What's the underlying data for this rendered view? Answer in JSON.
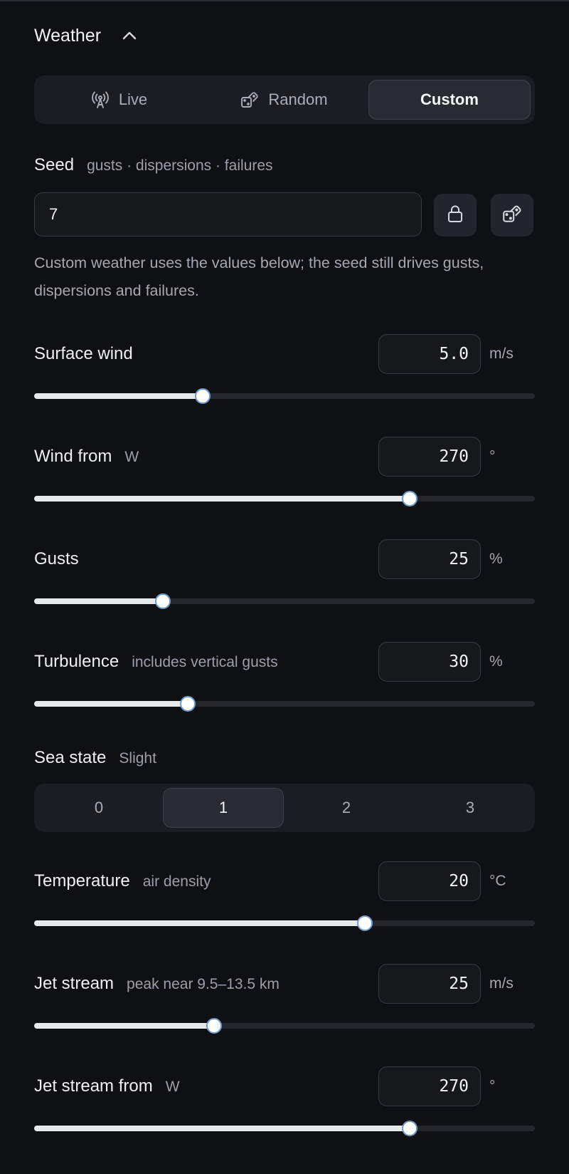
{
  "section": {
    "title": "Weather"
  },
  "mode_tabs": [
    {
      "label": "Live",
      "icon": "broadcast-icon",
      "active": false
    },
    {
      "label": "Random",
      "icon": "dice-icon",
      "active": false
    },
    {
      "label": "Custom",
      "active": true
    }
  ],
  "seed": {
    "label": "Seed",
    "sublabel": "gusts · dispersions · failures",
    "value": "7",
    "lock_icon": "lock-icon",
    "randomize_icon": "dice-icon",
    "help_text": "Custom weather uses the values below; the seed still drives gusts, dispersions and failures."
  },
  "params": {
    "surface_wind": {
      "label": "Surface wind",
      "sublabel": "",
      "value": "5.0",
      "unit": "m/s",
      "fraction": 0.337
    },
    "wind_from": {
      "label": "Wind from",
      "sublabel": "W",
      "value": "270",
      "unit": "°",
      "fraction": 0.75
    },
    "gusts": {
      "label": "Gusts",
      "sublabel": "",
      "value": "25",
      "unit": "%",
      "fraction": 0.257
    },
    "turbulence": {
      "label": "Turbulence",
      "sublabel": "includes vertical gusts",
      "value": "30",
      "unit": "%",
      "fraction": 0.307
    },
    "temperature": {
      "label": "Temperature",
      "sublabel": "air density",
      "value": "20",
      "unit": "°C",
      "fraction": 0.66
    },
    "jet_stream": {
      "label": "Jet stream",
      "sublabel": "peak near 9.5–13.5 km",
      "value": "25",
      "unit": "m/s",
      "fraction": 0.36
    },
    "jet_stream_from": {
      "label": "Jet stream from",
      "sublabel": "W",
      "value": "270",
      "unit": "°",
      "fraction": 0.75
    }
  },
  "sea_state": {
    "label": "Sea state",
    "sublabel": "Slight",
    "options": [
      "0",
      "1",
      "2",
      "3"
    ],
    "selected": "1"
  },
  "colors": {
    "background": "#0f1013",
    "slider_fill": "#e8e9eb",
    "thumb_border": "#6e9ccf"
  }
}
